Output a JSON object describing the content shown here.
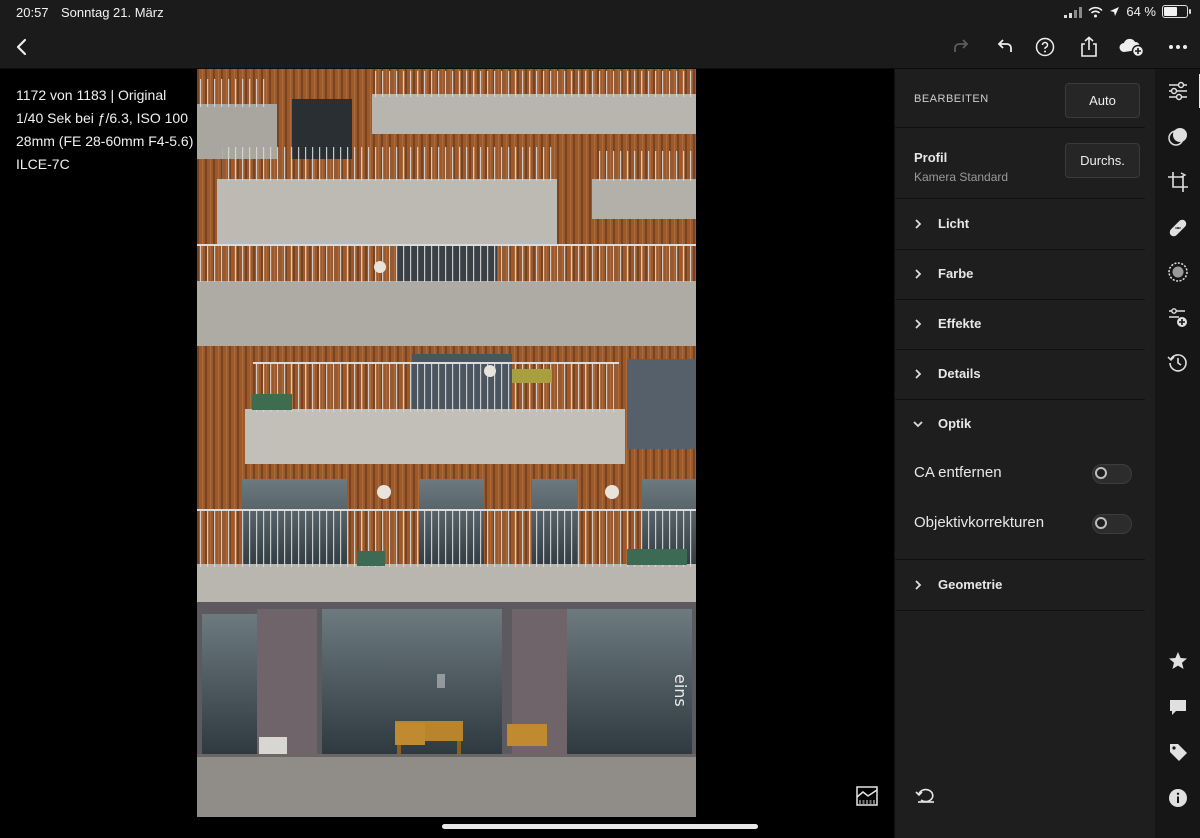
{
  "status_bar": {
    "time": "20:57",
    "date": "Sonntag 21. März",
    "battery_text": "64 %",
    "battery_level": 0.64,
    "icons": [
      "cellular-signal-icon",
      "wifi-icon",
      "location-arrow-icon",
      "battery-icon"
    ]
  },
  "top_bar": {
    "icons": [
      "back-chevron-icon",
      "redo-icon",
      "undo-icon",
      "help-icon",
      "share-icon",
      "cloud-add-icon",
      "more-icon"
    ]
  },
  "photo_info": {
    "line1": "1172 von 1183 | Original",
    "line2": "1/40 Sek bei ƒ/6.3, ISO 100",
    "line3": "28mm (FE 28-60mm F4-5.6)",
    "line4": "ILCE-7C",
    "image_text": "eins"
  },
  "panel": {
    "header": "BEARBEITEN",
    "auto_label": "Auto",
    "profile_title": "Profil",
    "profile_value": "Kamera Standard",
    "browse_label": "Durchs.",
    "sections": {
      "licht": "Licht",
      "farbe": "Farbe",
      "effekte": "Effekte",
      "details": "Details",
      "optik": "Optik",
      "geometrie": "Geometrie"
    },
    "optik": {
      "ca_label": "CA entfernen",
      "ca_on": false,
      "lens_label": "Objektivkorrekturen",
      "lens_on": false
    }
  },
  "tool_rail": {
    "icons": [
      "edit-sliders-icon",
      "presets-icon",
      "crop-icon",
      "healing-icon",
      "masking-icon",
      "versions-icon",
      "history-icon",
      "rating-star-icon",
      "comment-icon",
      "tag-icon",
      "info-icon"
    ]
  },
  "colors": {
    "panel_bg": "#1e1e1e",
    "topbar_bg": "#1b1b1b",
    "rail_bg": "#161616",
    "text": "#e6e6e6"
  }
}
